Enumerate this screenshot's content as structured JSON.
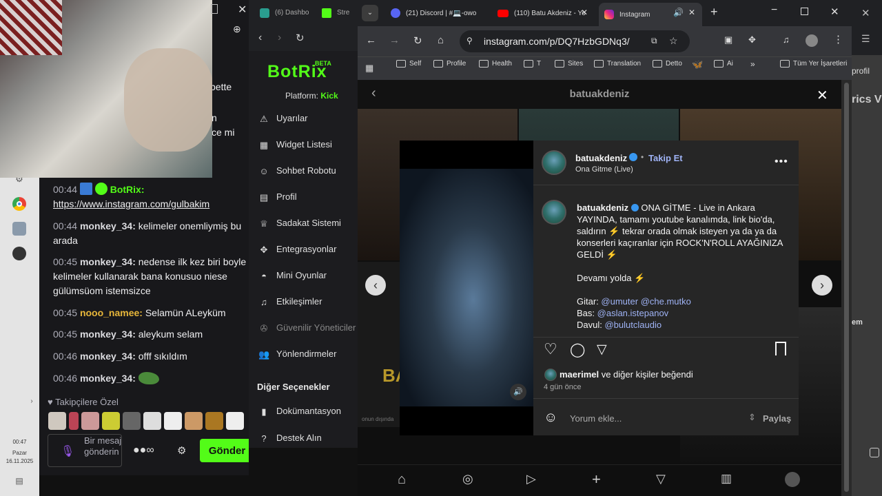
{
  "taskbar": {
    "time": "00:47",
    "day": "Pazar",
    "date": "16.11.2025"
  },
  "chat": {
    "partial_lines": [
      "bette",
      "n",
      "ce mi"
    ],
    "messages": [
      {
        "time": "00:44",
        "user": "BotRix:",
        "text": "https://www.instagram.com/gulbakim",
        "user_color": "#53fc18"
      },
      {
        "time": "00:44",
        "user": "monkey_34:",
        "text": "kelimeler onemliymiş bu arada"
      },
      {
        "time": "00:45",
        "user": "monkey_34:",
        "text": "nedense ilk kez biri boyle kelimeler kullanarak bana konusuo niese gülümsüom istemsizce"
      },
      {
        "time": "00:45",
        "user": "nooo_namee:",
        "text": "Selamün ALeyküm",
        "user_color": "#e8b73a"
      },
      {
        "time": "00:45",
        "user": "monkey_34:",
        "text": "aleykum selam"
      },
      {
        "time": "00:46",
        "user": "monkey_34:",
        "text": "offf sıkıldım"
      },
      {
        "time": "00:46",
        "user": "monkey_34:",
        "text": ""
      }
    ],
    "followers_label": "Takipçilere Özel",
    "input_placeholder": "Bir mesaj gönderin",
    "send_label": "Gönder"
  },
  "botrix": {
    "logo": "BotRix",
    "beta": "BETA",
    "platform_label": "Platform:",
    "platform": "Kick",
    "menu": [
      "Uyarılar",
      "Widget Listesi",
      "Sohbet Robotu",
      "Profil",
      "Sadakat Sistemi",
      "Entegrasyonlar",
      "Mini Oyunlar",
      "Etkileşimler",
      "Güvenilir Yöneticiler",
      "Yönlendirmeler"
    ],
    "section": "Diğer Seçenekler",
    "menu2": [
      "Dokümantasyon",
      "Destek Alın"
    ]
  },
  "browser": {
    "left_tabs": [
      "(6) Dashbo",
      "Stre"
    ],
    "tabs": [
      "(21) Discord | #💻-owo",
      "(110) Batu Akdeniz - Yo",
      "Instagram"
    ],
    "url": "instagram.com/p/DQ7HzbGDNq3/",
    "bookmarks": [
      "Self",
      "Profile",
      "Health",
      "T",
      "Sites",
      "Translation",
      "Detto",
      "Ai",
      "Tüm Yer İşaretleri"
    ],
    "profile_title": "batuakdeniz"
  },
  "post": {
    "username": "batuakdeniz",
    "follow": "Takip Et",
    "subtitle": "Ona Gitme (Live)",
    "caption_lines": [
      "ONA GİTME - Live in Ankara",
      "YAYINDA, tamamı youtube kanalımda, link bio'da,",
      "saldırın ⚡ tekrar orada olmak isteyen ya da ya da",
      "konserleri kaçıranlar için ROCK'N'ROLL AYAĞINIZA",
      "GELDİ ⚡"
    ],
    "more": "Devamı yolda ⚡",
    "credits": [
      {
        "label": "Gitar:",
        "handles": "@umuter @che.mutko"
      },
      {
        "label": "Bas:",
        "handles": "@aslan.istepanov"
      },
      {
        "label": "Davul:",
        "handles": "@bulutclaudio"
      }
    ],
    "likes_user": "maerimel",
    "likes_text": "ve diğer kişiler",
    "likes_suffix": "beğendi",
    "ago": "4 gün önce",
    "comment_placeholder": "Yorum ekle...",
    "share": "Paylaş"
  },
  "bg": {
    "left_text": "onun dışında",
    "right_a": "profil",
    "right_b": "rics V",
    "right_c": "em"
  }
}
